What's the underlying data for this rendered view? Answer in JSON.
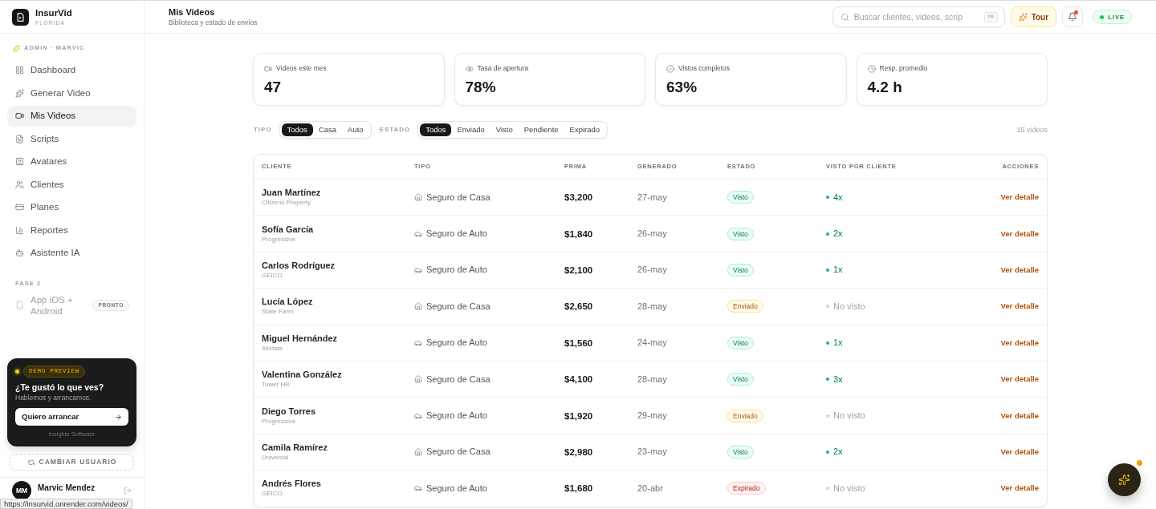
{
  "sidebar": {
    "brand": {
      "name": "InsurVid",
      "region": "FLORIDA"
    },
    "role_label": "ADMIN · MARVIC",
    "nav_items": [
      {
        "label": "Dashboard",
        "selected": false
      },
      {
        "label": "Generar Video",
        "selected": false
      },
      {
        "label": "Mis Videos",
        "selected": true
      },
      {
        "label": "Scripts",
        "selected": false
      },
      {
        "label": "Avatares",
        "selected": false
      },
      {
        "label": "Clientes",
        "selected": false
      },
      {
        "label": "Planes",
        "selected": false
      },
      {
        "label": "Reportes",
        "selected": false
      },
      {
        "label": "Asistente IA",
        "selected": false
      }
    ],
    "section_label": "FASE 2",
    "upcoming_items": [
      {
        "label": "App iOS + Android",
        "badge": "PRONTO",
        "disabled": true
      }
    ],
    "demo_card": {
      "badge": "DEMO PREVIEW",
      "title": "¿Te gustó lo que ves?",
      "subtitle": "Hablemos y arrancamos.",
      "button": "Quiero arrancar",
      "footer": "Insights Software"
    },
    "switch_user_button": "CAMBIAR USUARIO",
    "user": {
      "initials": "MM",
      "name": "Marvic Mendez"
    }
  },
  "header": {
    "title": "Mis Videos",
    "subtitle": "Biblioteca y estado de envíos",
    "search": {
      "placeholder": "Buscar clientes, videos, scrip",
      "shortcut": "⌘K"
    },
    "tour_button": "Tour",
    "notifications": {
      "unread": true
    },
    "status_badge": "LIVE"
  },
  "stats": [
    {
      "label": "Videos este mes",
      "value": "47"
    },
    {
      "label": "Tasa de apertura",
      "value": "78%"
    },
    {
      "label": "Vistos completos",
      "value": "63%"
    },
    {
      "label": "Resp. promedio",
      "value": "4.2 h"
    }
  ],
  "filters": [
    {
      "label": "TIPO",
      "options": [
        {
          "label": "Todos",
          "selected": true
        },
        {
          "label": "Casa",
          "selected": false
        },
        {
          "label": "Auto",
          "selected": false
        }
      ]
    },
    {
      "label": "ESTADO",
      "options": [
        {
          "label": "Todos",
          "selected": true
        },
        {
          "label": "Enviado",
          "selected": false
        },
        {
          "label": "Visto",
          "selected": false
        },
        {
          "label": "Pendiente",
          "selected": false
        },
        {
          "label": "Expirado",
          "selected": false
        }
      ]
    }
  ],
  "result_count": "15 videos",
  "table": {
    "columns": [
      "CLIENTE",
      "TIPO",
      "PRIMA",
      "GENERADO",
      "ESTADO",
      "VISTO POR CLIENTE",
      "ACCIONES"
    ],
    "rows": [
      {
        "client": "Juan Martínez",
        "carrier": "Citizens Property",
        "type": {
          "kind": "casa",
          "label": "Seguro de Casa"
        },
        "premium": "$3,200",
        "generated": "27-may",
        "status": {
          "kind": "visto",
          "label": "Visto"
        },
        "views": {
          "seen": true,
          "label": "4x"
        },
        "action": "Ver detalle"
      },
      {
        "client": "Sofía García",
        "carrier": "Progressive",
        "type": {
          "kind": "auto",
          "label": "Seguro de Auto"
        },
        "premium": "$1,840",
        "generated": "26-may",
        "status": {
          "kind": "visto",
          "label": "Visto"
        },
        "views": {
          "seen": true,
          "label": "2x"
        },
        "action": "Ver detalle"
      },
      {
        "client": "Carlos Rodríguez",
        "carrier": "GEICO",
        "type": {
          "kind": "auto",
          "label": "Seguro de Auto"
        },
        "premium": "$2,100",
        "generated": "26-may",
        "status": {
          "kind": "visto",
          "label": "Visto"
        },
        "views": {
          "seen": true,
          "label": "1x"
        },
        "action": "Ver detalle"
      },
      {
        "client": "Lucía López",
        "carrier": "State Farm",
        "type": {
          "kind": "casa",
          "label": "Seguro de Casa"
        },
        "premium": "$2,650",
        "generated": "28-may",
        "status": {
          "kind": "enviado",
          "label": "Enviado"
        },
        "views": {
          "seen": false,
          "label": "No visto"
        },
        "action": "Ver detalle"
      },
      {
        "client": "Miguel Hernández",
        "carrier": "Allstate",
        "type": {
          "kind": "auto",
          "label": "Seguro de Auto"
        },
        "premium": "$1,560",
        "generated": "24-may",
        "status": {
          "kind": "visto",
          "label": "Visto"
        },
        "views": {
          "seen": true,
          "label": "1x"
        },
        "action": "Ver detalle"
      },
      {
        "client": "Valentina González",
        "carrier": "Tower Hill",
        "type": {
          "kind": "casa",
          "label": "Seguro de Casa"
        },
        "premium": "$4,100",
        "generated": "28-may",
        "status": {
          "kind": "visto",
          "label": "Visto"
        },
        "views": {
          "seen": true,
          "label": "3x"
        },
        "action": "Ver detalle"
      },
      {
        "client": "Diego Torres",
        "carrier": "Progressive",
        "type": {
          "kind": "auto",
          "label": "Seguro de Auto"
        },
        "premium": "$1,920",
        "generated": "29-may",
        "status": {
          "kind": "enviado",
          "label": "Enviado"
        },
        "views": {
          "seen": false,
          "label": "No visto"
        },
        "action": "Ver detalle"
      },
      {
        "client": "Camila Ramírez",
        "carrier": "Universal",
        "type": {
          "kind": "casa",
          "label": "Seguro de Casa"
        },
        "premium": "$2,980",
        "generated": "23-may",
        "status": {
          "kind": "visto",
          "label": "Visto"
        },
        "views": {
          "seen": true,
          "label": "2x"
        },
        "action": "Ver detalle"
      },
      {
        "client": "Andrés Flores",
        "carrier": "GEICO",
        "type": {
          "kind": "auto",
          "label": "Seguro de Auto"
        },
        "premium": "$1,680",
        "generated": "20-abr",
        "status": {
          "kind": "expirado",
          "label": "Expirado"
        },
        "views": {
          "seen": false,
          "label": "No visto"
        },
        "action": "Ver detalle"
      }
    ]
  },
  "assistant_button": {
    "has_notification": true
  },
  "browser_status_url": "https://insurvid.onrender.com/videos/"
}
